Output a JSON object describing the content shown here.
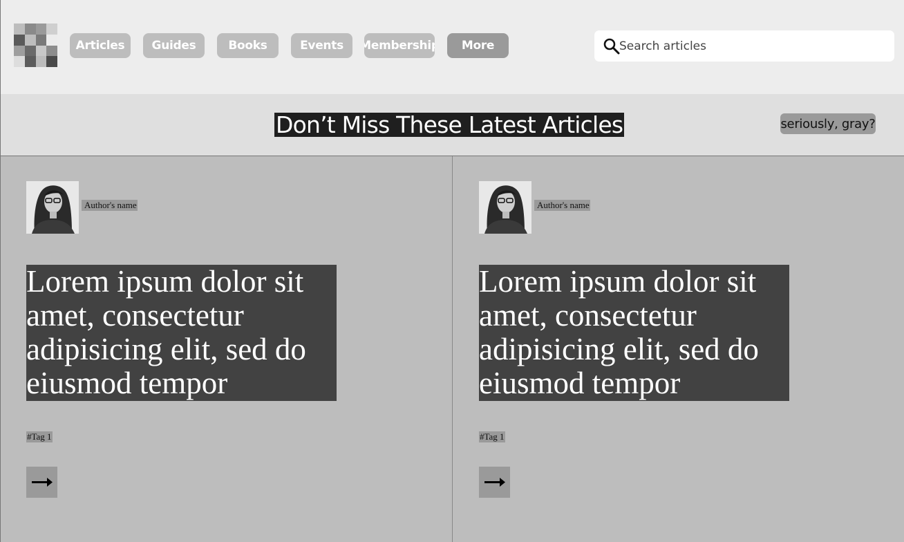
{
  "nav": {
    "items": [
      {
        "label": "Articles"
      },
      {
        "label": "Guides"
      },
      {
        "label": "Books"
      },
      {
        "label": "Events"
      },
      {
        "label": "Membership"
      },
      {
        "label": "More"
      }
    ]
  },
  "search": {
    "placeholder": "Search articles",
    "value": ""
  },
  "banner": {
    "title": "Don’t Miss These Latest Articles",
    "badge": "seriously, gray?"
  },
  "articles": [
    {
      "author": "Author's name",
      "headline": "Lorem ipsum dolor sit amet, consectetur adipisicing elit, sed do eiusmod tempor",
      "tag": "#Tag 1"
    },
    {
      "author": "Author's name",
      "headline": "Lorem ipsum dolor sit amet, consectetur adipisicing elit, sed do eiusmod tempor",
      "tag": "#Tag 1"
    }
  ],
  "colors": {
    "topbar": "#ededed",
    "banner": "#dfdfdf",
    "content": "#bdbdbd",
    "nav_button": "#bdbdbd",
    "nav_more": "#9a9a9a",
    "headline_bg": "#424242"
  },
  "icons": {
    "logo": "logo-mosaic",
    "search": "search-icon",
    "arrow": "arrow-right-icon"
  }
}
